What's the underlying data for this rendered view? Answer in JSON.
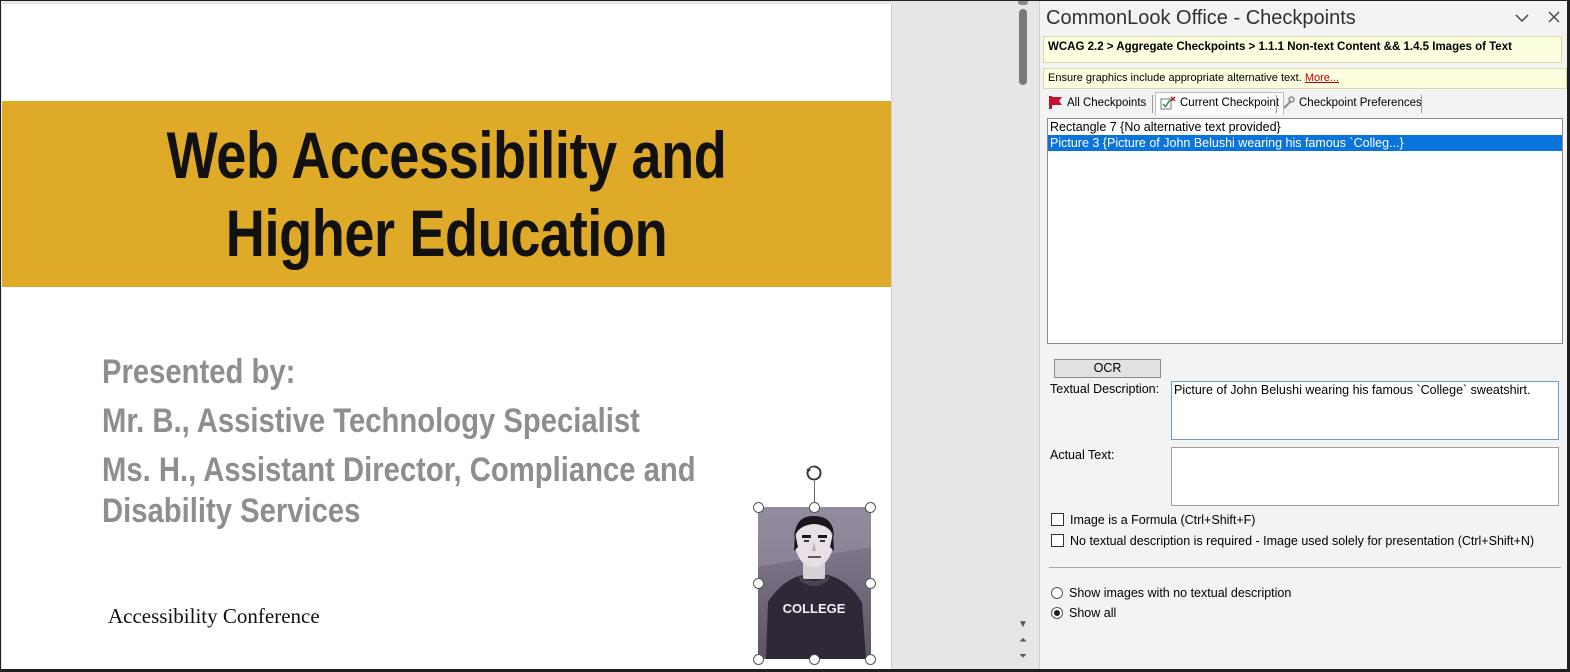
{
  "slide": {
    "title_line1": "Web Accessibility and",
    "title_line2": "Higher Education",
    "presenters": [
      "Presented by:",
      "Mr. B., Assistive Technology Specialist",
      "Ms. H., Assistant Director, Compliance and Disability Services"
    ],
    "footer": "Accessibility Conference",
    "picture_caption": "COLLEGE"
  },
  "colors": {
    "banner": "#e0aa29",
    "selection": "#0a74da"
  },
  "pane": {
    "title": "CommonLook Office - Checkpoints",
    "breadcrumb": "WCAG 2.2 > Aggregate Checkpoints > 1.1.1 Non-text Content && 1.4.5 Images of Text",
    "hint": "Ensure graphics include appropriate alternative text.",
    "hint_link": "More...",
    "tabs": [
      {
        "label": "All Checkpoints",
        "icon": "flag-icon"
      },
      {
        "label": "Current Checkpoint",
        "icon": "checklist-icon"
      },
      {
        "label": "Checkpoint Preferences",
        "icon": "preferences-icon"
      }
    ],
    "active_tab": "Current Checkpoint",
    "items": [
      "Rectangle 7 {No alternative text provided}",
      "Picture 3 {Picture of John Belushi wearing his famous `Colleg...}"
    ],
    "selected_item": 1,
    "ocr_label": "OCR",
    "textual_description_label": "Textual Description:",
    "textual_description_value": "Picture of John Belushi wearing his famous `College` sweatshirt.",
    "actual_text_label": "Actual Text:",
    "actual_text_value": "",
    "checkboxes": [
      {
        "label": "Image is a Formula (Ctrl+Shift+F)",
        "checked": false
      },
      {
        "label": "No textual description is required - Image used solely for presentation (Ctrl+Shift+N)",
        "checked": false
      }
    ],
    "radios": [
      {
        "label": "Show images with no textual description",
        "selected": false
      },
      {
        "label": "Show all",
        "selected": true
      }
    ]
  }
}
